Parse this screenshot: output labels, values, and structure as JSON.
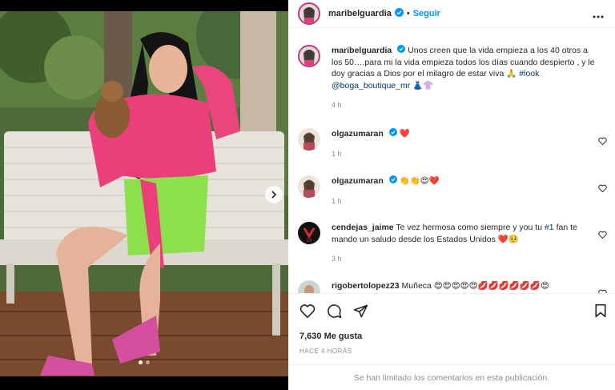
{
  "post": {
    "username": "maribelguardia",
    "follow_label": "Seguir",
    "more_label": "•••",
    "caption_text": "Unos creen que la vida empieza a los 40 otros a los 50….para mi la vida empieza todos los días cuando despierto , y le doy gracias a Dios por el milagro de estar viva 🙏",
    "caption_hashtag": "#look",
    "caption_mention": "@boga_boutique_mr",
    "caption_emoji": "👗👚",
    "caption_time": "4 h"
  },
  "comments": [
    {
      "user": "olgazumaran",
      "text": "❤️",
      "time": "1 h",
      "verified": true
    },
    {
      "user": "olgazumaran",
      "text": "👏👏😍❤️",
      "time": "1 h",
      "verified": true
    },
    {
      "user": "cendejas_jaime",
      "text_before": "Te vez hermosa como siempre y you tu",
      "hashtag": "#1",
      "text_after": "fan te mando un saludo desde los Estados Unidos ❤️🥺",
      "time": "3 h",
      "verified": false
    },
    {
      "user": "rigobertolopez23",
      "text": "Muñeca 😍😍😍😍😍💋💋💋💋💋💋😍",
      "verified": false
    }
  ],
  "stats": {
    "likes": "7,630 Me gusta",
    "ago": "HACE 4 HORAS",
    "comments_limited": "Se han limitado los comentarios en esta publicación."
  },
  "colors": {
    "accent": "#0095f6",
    "verified": "#0095f6",
    "like_red": "#ed4956"
  },
  "icons": [
    "heart-icon",
    "comment-icon",
    "share-icon",
    "save-icon",
    "more-icon",
    "next-arrow-icon"
  ]
}
